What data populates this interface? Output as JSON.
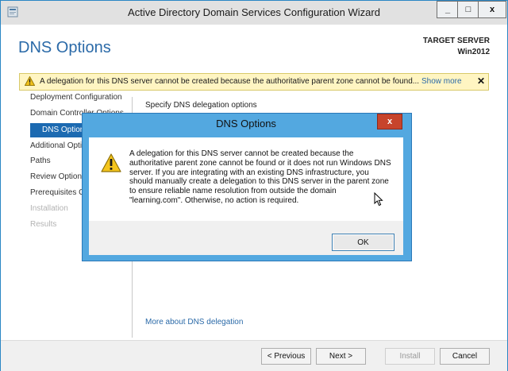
{
  "window": {
    "title": "Active Directory Domain Services Configuration Wizard",
    "controls": {
      "minimize": "_",
      "maximize": "□",
      "close": "x"
    }
  },
  "page": {
    "heading": "DNS Options",
    "target_server_label": "TARGET SERVER",
    "target_server_name": "Win2012"
  },
  "warning_bar": {
    "text": "A delegation for this DNS server cannot be created because the authoritative parent zone cannot be found...",
    "show_more": "Show more",
    "close": "✕",
    "icon": "warning-icon"
  },
  "nav": {
    "items": [
      {
        "label": "Deployment Configuration",
        "state": "normal"
      },
      {
        "label": "Domain Controller Options",
        "state": "normal"
      },
      {
        "label": "DNS Options",
        "state": "selected"
      },
      {
        "label": "Additional Options",
        "state": "normal"
      },
      {
        "label": "Paths",
        "state": "normal"
      },
      {
        "label": "Review Options",
        "state": "normal"
      },
      {
        "label": "Prerequisites Check",
        "state": "normal"
      },
      {
        "label": "Installation",
        "state": "disabled"
      },
      {
        "label": "Results",
        "state": "disabled"
      }
    ]
  },
  "content": {
    "subtitle": "Specify DNS delegation options",
    "more_link": "More about DNS delegation"
  },
  "footer": {
    "previous": "< Previous",
    "next": "Next >",
    "install": "Install",
    "cancel": "Cancel"
  },
  "dialog": {
    "title": "DNS Options",
    "close": "x",
    "message": "A delegation for this DNS server cannot be created because the authoritative parent zone cannot be found or it does not run Windows DNS server. If you are integrating with an existing DNS infrastructure, you should manually create a delegation to this DNS server in the parent zone to ensure reliable name resolution from outside the domain \"learning.com\". Otherwise, no action is required.",
    "ok": "OK",
    "icon": "warning-icon"
  },
  "colors": {
    "accent": "#2b6aa8",
    "nav_selected": "#1c6ab1",
    "dialog_frame": "#53a8e0",
    "close_red": "#c7442c",
    "warning_bar_bg": "#fff5c2"
  }
}
